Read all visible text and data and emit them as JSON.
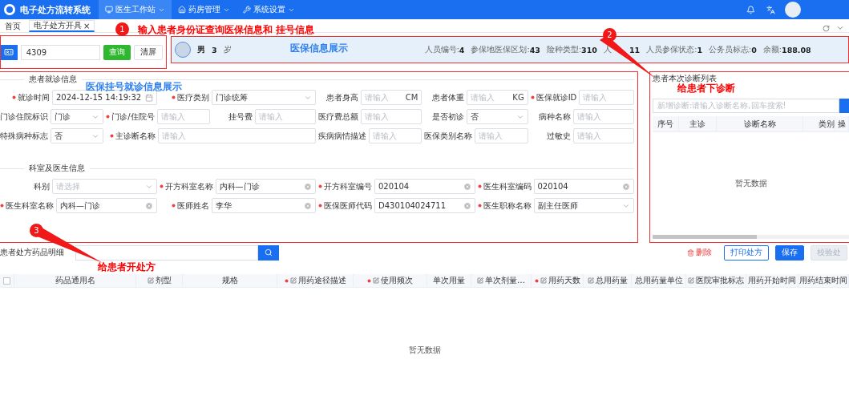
{
  "header": {
    "title": "电子处方流转系统",
    "menus": [
      {
        "label": "医生工作站",
        "selected": true
      },
      {
        "label": "药房管理",
        "selected": false
      },
      {
        "label": "系统设置",
        "selected": false
      }
    ]
  },
  "tabs": [
    {
      "label": "首页",
      "selected": false
    },
    {
      "label": "电子处方开具",
      "selected": true,
      "close": "×"
    }
  ],
  "id_search": {
    "value": "4309",
    "button": "查询",
    "clear": "清屏"
  },
  "patient": {
    "gender": "男",
    "age": "3",
    "age_unit": "岁",
    "fields": [
      {
        "label": "人员编号:",
        "value": "4"
      },
      {
        "label": "参保地医保区划:",
        "value": "43"
      },
      {
        "label": "险种类型:",
        "value": "310"
      },
      {
        "label": "人",
        "value": "11",
        "obscured": true
      },
      {
        "label": "人员参保状态:",
        "value": "1"
      },
      {
        "label": "公务员标志:",
        "value": "0"
      },
      {
        "label": "余额:",
        "value": "188.08"
      }
    ]
  },
  "form_sections": [
    {
      "title": "患者就诊信息",
      "fields": [
        {
          "label": "就诊时间",
          "required": true,
          "kind": "date",
          "value": "2024-12-15 14:19:32"
        },
        {
          "label": "医疗类别",
          "required": true,
          "kind": "select",
          "value": "门诊统筹"
        },
        {
          "label": "患者身高",
          "required": false,
          "kind": "unit",
          "placeholder": "请输入",
          "unit": "CM"
        },
        {
          "label": "患者体重",
          "required": false,
          "kind": "unit",
          "placeholder": "请输入",
          "unit": "KG"
        },
        {
          "label": "医保就诊ID",
          "required": true,
          "kind": "input",
          "placeholder": "请输入"
        },
        {
          "label": "门诊住院标识",
          "required": false,
          "kind": "select",
          "value": "门诊"
        },
        {
          "label": "门诊/住院号",
          "required": true,
          "kind": "input",
          "placeholder": "请输入"
        },
        {
          "label": "挂号费",
          "required": false,
          "kind": "input",
          "placeholder": "请输入"
        },
        {
          "label": "医疗费总额",
          "required": false,
          "kind": "input",
          "placeholder": "请输入"
        },
        {
          "label": "是否初诊",
          "required": false,
          "kind": "select",
          "value": "否"
        },
        {
          "label": "病种名称",
          "required": false,
          "kind": "input",
          "placeholder": "请输入"
        },
        {
          "label": "特殊病种标志",
          "required": false,
          "kind": "select",
          "value": "否"
        },
        {
          "label": "主诊断名称",
          "required": true,
          "kind": "input",
          "placeholder": "请输入"
        },
        {
          "label": "疾病病情描述",
          "required": false,
          "kind": "input",
          "placeholder": "请输入"
        },
        {
          "label": "医保类别名称",
          "required": false,
          "kind": "input",
          "placeholder": "请输入"
        },
        {
          "label": "过敏史",
          "required": false,
          "kind": "input",
          "placeholder": "请输入"
        }
      ]
    },
    {
      "title": "科室及医生信息",
      "fields": [
        {
          "label": "科别",
          "required": false,
          "kind": "select",
          "placeholder": "请选择"
        },
        {
          "label": "开方科室名称",
          "required": true,
          "kind": "clearable",
          "value": "内科—门诊"
        },
        {
          "label": "开方科室编号",
          "required": true,
          "kind": "clearable",
          "value": "020104"
        },
        {
          "label": "医生科室编码",
          "required": true,
          "kind": "clearable",
          "value": "020104"
        },
        {
          "label": "医生科室名称",
          "required": true,
          "kind": "clearable",
          "value": "内科—门诊"
        },
        {
          "label": "医师姓名",
          "required": true,
          "kind": "clearable",
          "value": "李华"
        },
        {
          "label": "医保医师代码",
          "required": true,
          "kind": "clearable",
          "value": "D430104024711"
        },
        {
          "label": "医生职称名称",
          "required": true,
          "kind": "select",
          "value": "副主任医师"
        }
      ]
    }
  ],
  "diagnosis": {
    "title": "患者本次诊断列表",
    "search_placeholder": "新增诊断:请输入诊断名称,回车搜索!",
    "columns": [
      "序号",
      "主诊",
      "诊断名称",
      "类别",
      "操"
    ],
    "empty": "暂无数据"
  },
  "prescription": {
    "title": "患者处方药品明细",
    "select_all": {
      "checked": false
    },
    "actions": [
      {
        "kind": "danger",
        "label": "删除"
      },
      {
        "kind": "outline",
        "label": "打印处方"
      },
      {
        "kind": "primary",
        "label": "保存"
      },
      {
        "kind": "disabled",
        "label": "校验处"
      }
    ],
    "columns": [
      {
        "label": "药品通用名",
        "required": false,
        "editable": false
      },
      {
        "label": "剂型",
        "required": false,
        "editable": true
      },
      {
        "label": "规格",
        "required": false,
        "editable": false
      },
      {
        "label": "用药途径描述",
        "required": true,
        "editable": true
      },
      {
        "label": "使用频次",
        "required": true,
        "editable": true
      },
      {
        "label": "单次用量",
        "required": false,
        "editable": false
      },
      {
        "label": "单次剂量…",
        "required": false,
        "editable": true
      },
      {
        "label": "用药天数",
        "required": true,
        "editable": true
      },
      {
        "label": "总用药量",
        "required": false,
        "editable": true
      },
      {
        "label": "总用药量单位",
        "required": false,
        "editable": false
      },
      {
        "label": "医院审批标志",
        "required": false,
        "editable": true
      },
      {
        "label": "用药开始时间",
        "required": false,
        "editable": false
      },
      {
        "label": "用药结束时间",
        "required": false,
        "editable": false
      }
    ],
    "empty": "暂无数据"
  },
  "annotations": {
    "badges": [
      "1",
      "2",
      "3"
    ],
    "notes": [
      {
        "text": "输入患者身份证查询医保信息和 挂号信息",
        "color": "#ff0000"
      },
      {
        "text": "医保信息展示",
        "color": "#2f80ed"
      },
      {
        "text": "医保挂号就诊信息展示",
        "color": "#2f80ed"
      },
      {
        "text": "给患者下诊断",
        "color": "#ff0000"
      },
      {
        "text": "给患者开处方",
        "color": "#ff0000"
      }
    ]
  }
}
